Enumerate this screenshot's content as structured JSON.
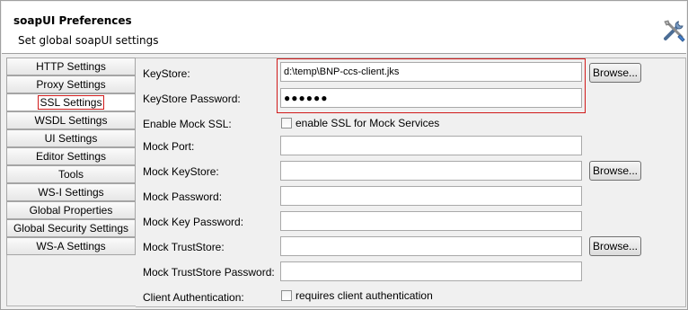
{
  "header": {
    "title": "soapUI Preferences",
    "subtitle": "Set global soapUI settings",
    "icon": "tools-icon"
  },
  "tabs": [
    {
      "label": "HTTP Settings",
      "selected": false
    },
    {
      "label": "Proxy Settings",
      "selected": false
    },
    {
      "label": "SSL Settings",
      "selected": true
    },
    {
      "label": "WSDL Settings",
      "selected": false
    },
    {
      "label": "UI Settings",
      "selected": false
    },
    {
      "label": "Editor Settings",
      "selected": false
    },
    {
      "label": "Tools",
      "selected": false
    },
    {
      "label": "WS-I Settings",
      "selected": false
    },
    {
      "label": "Global Properties",
      "selected": false
    },
    {
      "label": "Global Security Settings",
      "selected": false
    },
    {
      "label": "WS-A Settings",
      "selected": false
    }
  ],
  "form": {
    "keystore_label": "KeyStore:",
    "keystore_value": "d:\\temp\\BNP-ccs-client.jks",
    "keystore_browse": "Browse...",
    "keystore_password_label": "KeyStore Password:",
    "keystore_password_value": "●●●●●●",
    "enable_mock_ssl_label": "Enable Mock SSL:",
    "enable_mock_ssl_checkbox": "enable SSL for Mock Services",
    "mock_port_label": "Mock Port:",
    "mock_port_value": "",
    "mock_keystore_label": "Mock KeyStore:",
    "mock_keystore_value": "",
    "mock_keystore_browse": "Browse...",
    "mock_password_label": "Mock Password:",
    "mock_password_value": "",
    "mock_key_password_label": "Mock Key Password:",
    "mock_key_password_value": "",
    "mock_truststore_label": "Mock TrustStore:",
    "mock_truststore_value": "",
    "mock_truststore_browse": "Browse...",
    "mock_truststore_password_label": "Mock TrustStore Password:",
    "mock_truststore_password_value": "",
    "client_auth_label": "Client Authentication:",
    "client_auth_checkbox": "requires client authentication"
  },
  "colors": {
    "highlight": "#d01a1a",
    "header_bg": "#ffffff",
    "panel_bg": "#f0f0f0"
  }
}
